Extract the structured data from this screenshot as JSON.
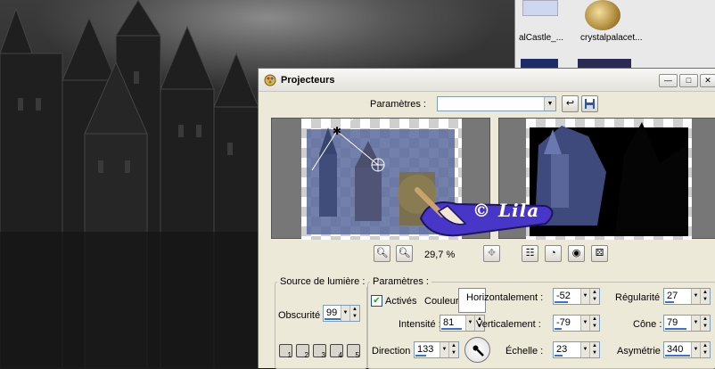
{
  "thumbnails": [
    {
      "label": "alCastle_..."
    },
    {
      "label": "crystalpalacet..."
    }
  ],
  "dialog": {
    "title": "Projecteurs",
    "window_buttons": {
      "minimize": "—",
      "maximize": "□",
      "close": "✕"
    },
    "params_label": "Paramètres :",
    "preset_value": "",
    "zoom_level": "29,7 %",
    "watermark_text": "© Lila",
    "light_source": {
      "title": "Source de lumière :",
      "darkness_label": "Obscurité :",
      "darkness_value": "99",
      "preset_badges": [
        "1",
        "2",
        "3",
        "4",
        "5"
      ]
    },
    "params": {
      "title": "Paramètres :",
      "active_label": "Activés",
      "active_checked": true,
      "color_label": "Couleur :",
      "color_value": "#ffffff",
      "intensity_label": "Intensité :",
      "intensity_value": "81",
      "direction_label": "Direction :",
      "direction_value": "133",
      "horizontal_label": "Horizontalement :",
      "horizontal_value": "-52",
      "vertical_label": "Verticalement :",
      "vertical_value": "-79",
      "scale_label": "Échelle :",
      "scale_value": "23",
      "regularity_label": "Régularité :",
      "regularity_value": "27",
      "cone_label": "Cône :",
      "cone_value": "79",
      "asymmetry_label": "Asymétrie :",
      "asymmetry_value": "340"
    }
  },
  "colors": {
    "accent": "#3b6fe0",
    "dialog_bg": "#ece9d8"
  }
}
